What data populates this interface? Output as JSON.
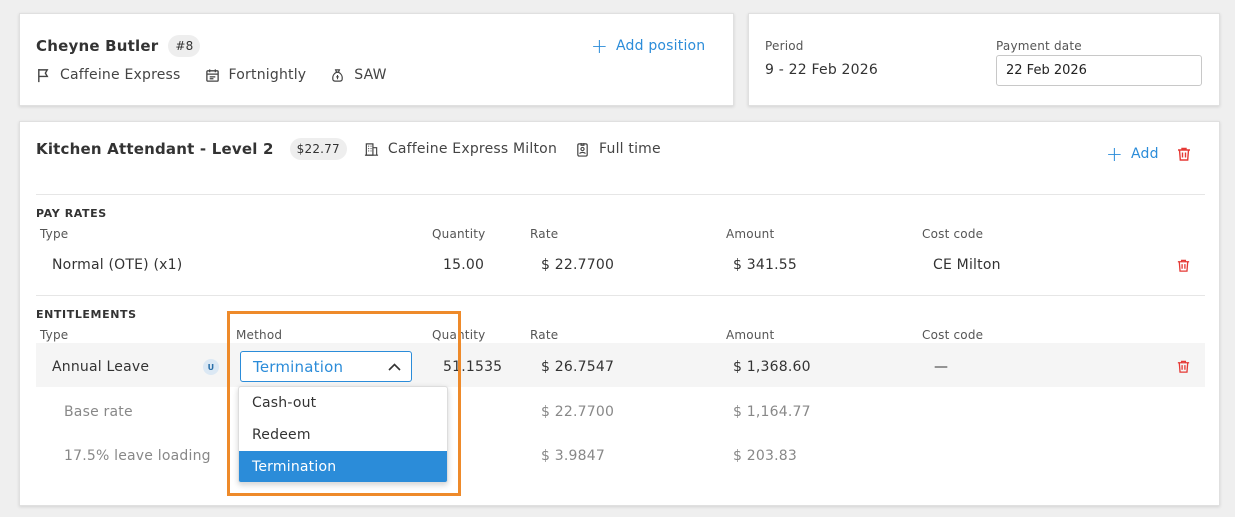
{
  "employee": {
    "name": "Cheyne Butler",
    "number": "#8",
    "business": "Caffeine Express",
    "frequency": "Fortnightly",
    "award": "SAW",
    "add_position_label": "Add position",
    "add_position_plus": "+"
  },
  "period": {
    "period_label": "Period",
    "period_value": "9 - 22 Feb 2026",
    "payment_date_label": "Payment date",
    "payment_date_value": "22 Feb 2026"
  },
  "position": {
    "title": "Kitchen Attendant - Level 2",
    "rate_badge": "$22.77",
    "location": "Caffeine Express Milton",
    "employment_type": "Full time",
    "add_label": "Add",
    "add_plus": "+"
  },
  "pay_rates": {
    "section_title": "PAY RATES",
    "headers": {
      "type": "Type",
      "quantity": "Quantity",
      "rate": "Rate",
      "amount": "Amount",
      "cost_code": "Cost code"
    },
    "rows": [
      {
        "type": "Normal (OTE) (x1)",
        "quantity": "15.00",
        "rate": "$ 22.7700",
        "amount": "$ 341.55",
        "cost_code": "CE Milton"
      }
    ]
  },
  "entitlements": {
    "section_title": "ENTITLEMENTS",
    "headers": {
      "type": "Type",
      "method": "Method",
      "quantity": "Quantity",
      "rate": "Rate",
      "amount": "Amount",
      "cost_code": "Cost code"
    },
    "row": {
      "type": "Annual Leave",
      "badge": "U",
      "method": "Termination",
      "quantity": "51.1535",
      "rate": "$ 26.7547",
      "amount": "$ 1,368.60",
      "cost_code": "—"
    },
    "sub_rows": [
      {
        "type": "Base rate",
        "rate": "$ 22.7700",
        "amount": "$ 1,164.77"
      },
      {
        "type": "17.5% leave loading",
        "rate": "$ 3.9847",
        "amount": "$ 203.83"
      }
    ],
    "method_options": [
      "Cash-out",
      "Redeem",
      "Termination"
    ]
  },
  "colors": {
    "accent": "#2b8cd9",
    "danger": "#e53935",
    "highlight": "#ee8a2a"
  },
  "icons": [
    "flag-icon",
    "calendar-icon",
    "money-bag-icon",
    "building-icon",
    "badge-icon",
    "trash-icon",
    "chevron-up-icon"
  ]
}
